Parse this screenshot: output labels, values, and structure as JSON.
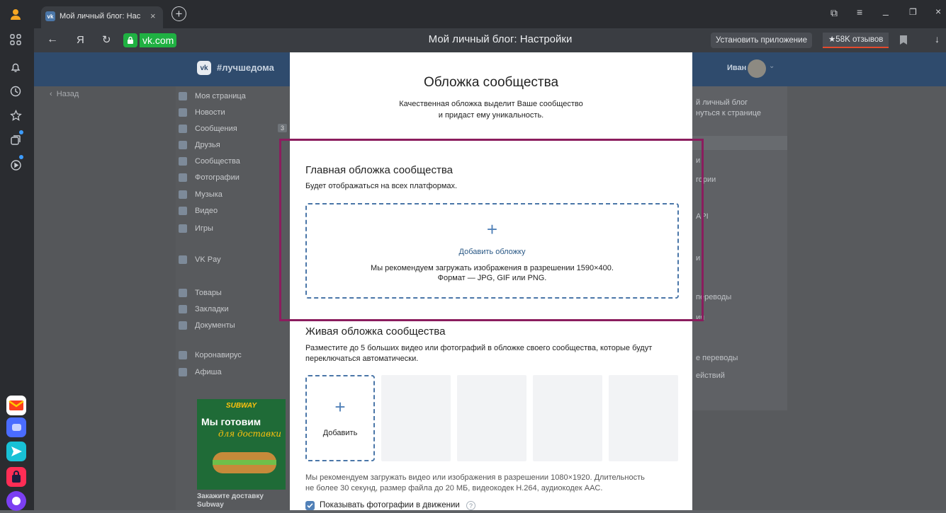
{
  "browser": {
    "tab_title": "Мой личный блог: Нас",
    "page_title": "Мой личный блог: Настройки",
    "domain": "vk.com",
    "yandex_glyph": "Я",
    "install_app": "Установить приложение",
    "reviews": "★58K отзывов"
  },
  "vk": {
    "hashtag": "#лучшедома",
    "back": "Назад",
    "user_name": "Иван",
    "menu": [
      {
        "label": "Моя страница"
      },
      {
        "label": "Новости"
      },
      {
        "label": "Сообщения",
        "badge": "3"
      },
      {
        "label": "Друзья"
      },
      {
        "label": "Сообщества"
      },
      {
        "label": "Фотографии"
      },
      {
        "label": "Музыка"
      },
      {
        "label": "Видео"
      },
      {
        "label": "Игры"
      },
      {
        "label": "VK Pay"
      },
      {
        "label": "Товары"
      },
      {
        "label": "Закладки"
      },
      {
        "label": "Документы"
      },
      {
        "label": "Коронавирус"
      },
      {
        "label": "Афиша"
      }
    ],
    "ad": {
      "brand": "SUBWAY",
      "headline": "Мы готовим",
      "script": "для доставки",
      "caption_line1": "Закажите доставку",
      "caption_line2": "Subway"
    },
    "right_panel": {
      "line1": "й личный блог",
      "line2": "нуться к странице",
      "items": [
        "и",
        "гории",
        "API",
        "и",
        "переводы",
        "ия",
        "е переводы",
        "ействий"
      ]
    }
  },
  "modal": {
    "title": "Обложка сообщества",
    "subtitle_line1": "Качественная обложка выделит Ваше сообщество",
    "subtitle_line2": "и придаст ему уникальность.",
    "main": {
      "heading": "Главная обложка сообщества",
      "desc": "Будет отображаться на всех платформах.",
      "add_label": "Добавить обложку",
      "rec_line1": "Мы рекомендуем загружать изображения в разрешении 1590×400.",
      "rec_line2": "Формат — JPG, GIF или PNG."
    },
    "live": {
      "heading": "Живая обложка сообщества",
      "desc_line1": "Разместите до 5 больших видео или фотографий в обложке своего сообщества, которые будут",
      "desc_line2": "переключаться автоматически.",
      "add_label": "Добавить",
      "rec_line1": "Мы рекомендуем загружать видео или изображения в разрешении 1080×1920. Длительность",
      "rec_line2": "не более 30 секунд, размер файла до 20 МБ, видеокодек H.264, аудиокодек AAC.",
      "checkbox_label": "Показывать фотографии в движении",
      "checkbox_checked": true
    }
  },
  "colors": {
    "accent": "#5181b8",
    "highlight": "#8b1d5e",
    "dashed": "#4a76a8"
  }
}
